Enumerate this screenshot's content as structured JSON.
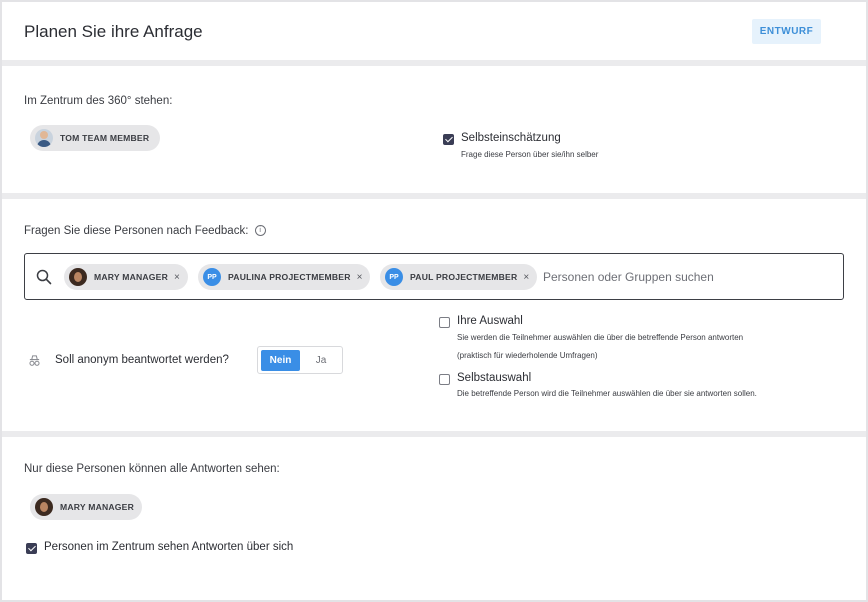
{
  "header": {
    "title": "Planen Sie ihre Anfrage",
    "status_badge": "ENTWURF"
  },
  "center_section": {
    "label": "Im Zentrum des 360° stehen:",
    "person": {
      "name": "TOM TEAM MEMBER",
      "icon": "person-avatar"
    },
    "self_assessment": {
      "checked": true,
      "title": "Selbsteinschätzung",
      "description": "Frage diese Person über sie/ihn selber"
    }
  },
  "feedback_section": {
    "label": "Fragen Sie diese Personen nach Feedback:",
    "info_icon": "info-icon",
    "search_icon": "search-icon",
    "chips": [
      {
        "name": "MARY MANAGER",
        "initials": ""
      },
      {
        "name": "PAULINA PROJECTMEMBER",
        "initials": "PP"
      },
      {
        "name": "PAUL PROJECTMEMBER",
        "initials": "PP"
      }
    ],
    "chip_remove": "×",
    "search_placeholder": "Personen oder Gruppen suchen",
    "anonymous": {
      "icon": "incognito-icon",
      "label": "Soll anonym beantwortet werden?",
      "options": [
        "Nein",
        "Ja"
      ],
      "selected": "Nein"
    },
    "choice_options": [
      {
        "checked": false,
        "title": "Ihre Auswahl",
        "description_line1": "Sie werden die Teilnehmer auswählen die über die betreffende Person antworten",
        "description_line2": "(praktisch für wiederholende Umfragen)"
      },
      {
        "checked": false,
        "title": "Selbstauswahl",
        "description_line1": "Die betreffende Person wird die Teilnehmer auswählen die über sie antworten sollen."
      }
    ]
  },
  "visibility_section": {
    "label": "Nur diese Personen können alle Antworten sehen:",
    "person": {
      "name": "MARY MANAGER"
    },
    "center_sees_answers": {
      "checked": true,
      "label": "Personen im Zentrum sehen Antworten über sich"
    }
  },
  "colors": {
    "accent": "#3a8ee6",
    "badge_bg": "#e6f2fc",
    "badge_text": "#3d8fd8",
    "checkbox_checked": "#3a3d55"
  }
}
